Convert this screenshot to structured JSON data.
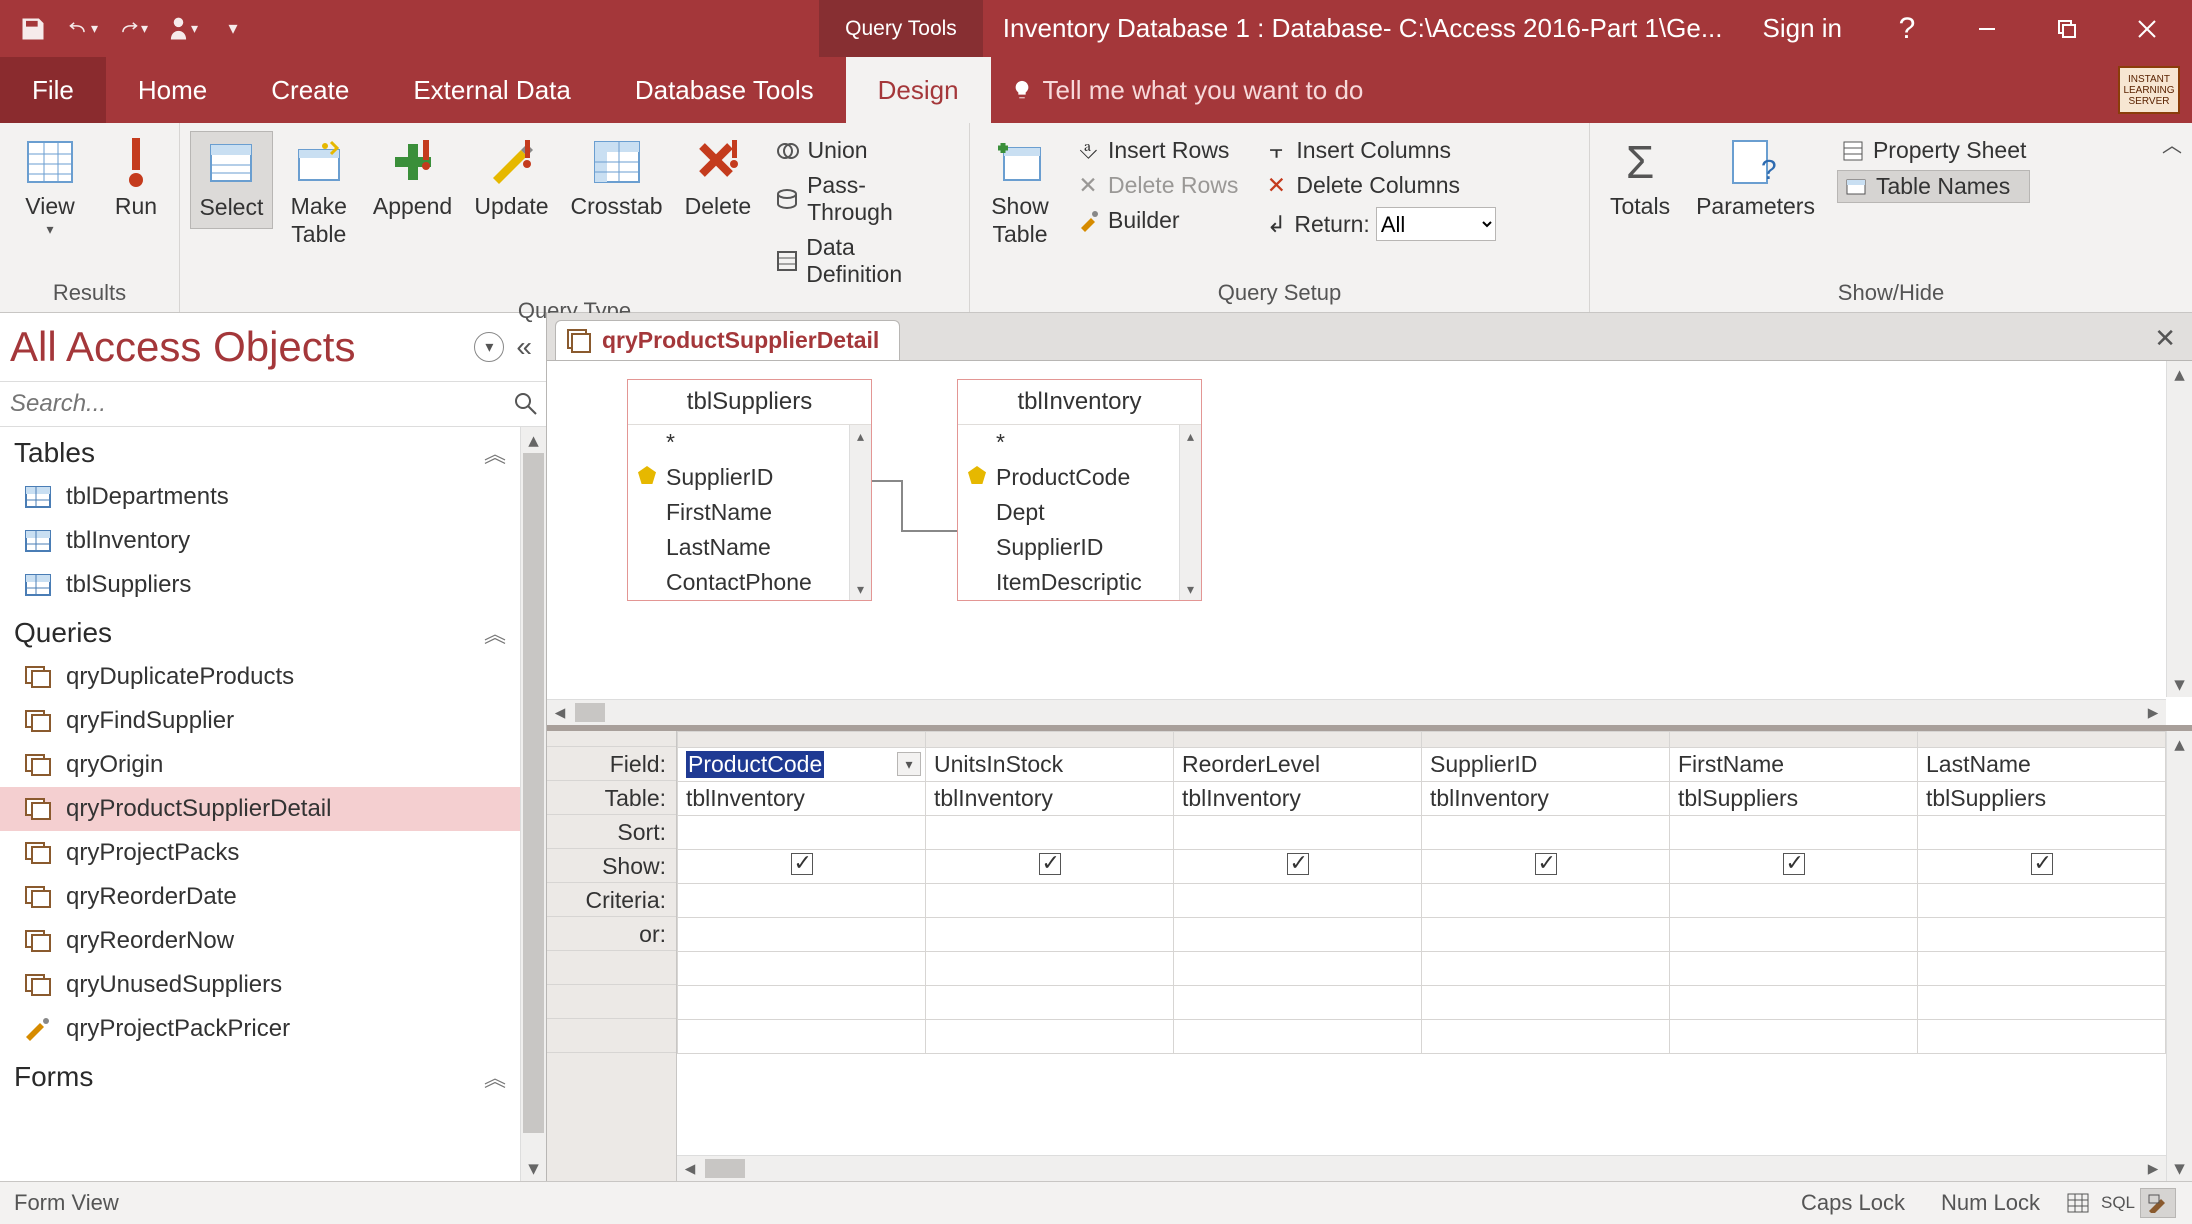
{
  "titlebar": {
    "tool_tab": "Query Tools",
    "title": "Inventory Database 1 : Database- C:\\Access 2016-Part 1\\Ge...",
    "sign_in": "Sign in"
  },
  "ribbon_tabs": {
    "file": "File",
    "home": "Home",
    "create": "Create",
    "external_data": "External Data",
    "database_tools": "Database Tools",
    "design": "Design",
    "tell_me": "Tell me what you want to do"
  },
  "ribbon": {
    "results": {
      "label": "Results",
      "view": "View",
      "run": "Run"
    },
    "query_type": {
      "label": "Query Type",
      "select": "Select",
      "make_table": "Make\nTable",
      "append": "Append",
      "update": "Update",
      "crosstab": "Crosstab",
      "delete": "Delete",
      "union": "Union",
      "pass_through": "Pass-Through",
      "data_definition": "Data Definition"
    },
    "query_setup": {
      "label": "Query Setup",
      "show_table": "Show\nTable",
      "insert_rows": "Insert Rows",
      "delete_rows": "Delete Rows",
      "builder": "Builder",
      "insert_columns": "Insert Columns",
      "delete_columns": "Delete Columns",
      "return": "Return:",
      "return_value": "All"
    },
    "show_hide": {
      "label": "Show/Hide",
      "totals": "Totals",
      "parameters": "Parameters",
      "property_sheet": "Property Sheet",
      "table_names": "Table Names"
    }
  },
  "nav": {
    "title": "All Access Objects",
    "search_placeholder": "Search...",
    "groups": {
      "tables": {
        "label": "Tables",
        "items": [
          "tblDepartments",
          "tblInventory",
          "tblSuppliers"
        ]
      },
      "queries": {
        "label": "Queries",
        "items": [
          "qryDuplicateProducts",
          "qryFindSupplier",
          "qryOrigin",
          "qryProductSupplierDetail",
          "qryProjectPacks",
          "qryReorderDate",
          "qryReorderNow",
          "qryUnusedSuppliers",
          "qryProjectPackPricer"
        ],
        "selected_index": 3
      },
      "forms": {
        "label": "Forms"
      }
    }
  },
  "document": {
    "tab_label": "qryProductSupplierDetail",
    "tables": [
      {
        "name": "tblSuppliers",
        "fields": [
          "*",
          "SupplierID",
          "FirstName",
          "LastName",
          "ContactPhone"
        ],
        "key_index": 1
      },
      {
        "name": "tblInventory",
        "fields": [
          "*",
          "ProductCode",
          "Dept",
          "SupplierID",
          "ItemDescriptic"
        ],
        "key_index": 1
      }
    ],
    "grid": {
      "row_labels": [
        "Field:",
        "Table:",
        "Sort:",
        "Show:",
        "Criteria:",
        "or:"
      ],
      "columns": [
        {
          "field": "ProductCode",
          "table": "tblInventory",
          "show": true,
          "active": true
        },
        {
          "field": "UnitsInStock",
          "table": "tblInventory",
          "show": true
        },
        {
          "field": "ReorderLevel",
          "table": "tblInventory",
          "show": true
        },
        {
          "field": "SupplierID",
          "table": "tblInventory",
          "show": true
        },
        {
          "field": "FirstName",
          "table": "tblSuppliers",
          "show": true
        },
        {
          "field": "LastName",
          "table": "tblSuppliers",
          "show": true
        }
      ]
    }
  },
  "statusbar": {
    "left": "Form View",
    "caps": "Caps Lock",
    "num": "Num Lock",
    "sql": "SQL"
  }
}
